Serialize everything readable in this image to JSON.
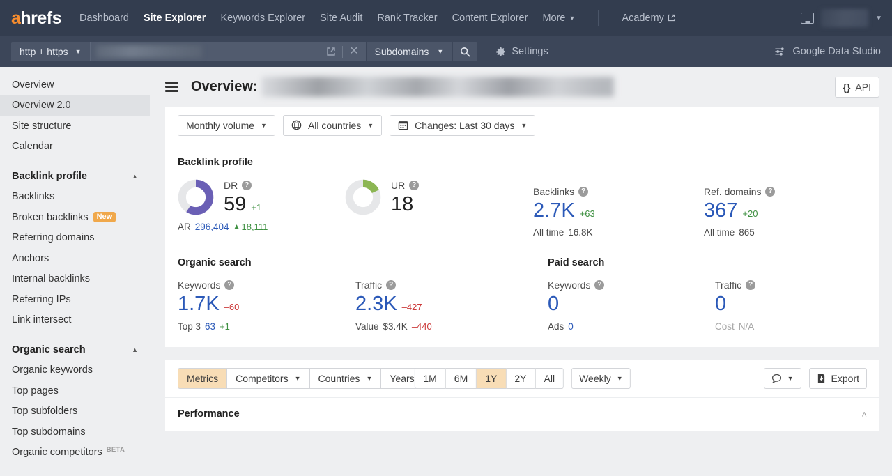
{
  "brand": {
    "logo_a": "a",
    "logo_rest": "hrefs",
    "accent": "#f68c2e"
  },
  "topnav": {
    "links": [
      {
        "label": "Dashboard",
        "active": false,
        "caret": false,
        "external": false
      },
      {
        "label": "Site Explorer",
        "active": true,
        "caret": false,
        "external": false
      },
      {
        "label": "Keywords Explorer",
        "active": false,
        "caret": false,
        "external": false
      },
      {
        "label": "Site Audit",
        "active": false,
        "caret": false,
        "external": false
      },
      {
        "label": "Rank Tracker",
        "active": false,
        "caret": false,
        "external": false
      },
      {
        "label": "Content Explorer",
        "active": false,
        "caret": false,
        "external": false
      },
      {
        "label": "More",
        "active": false,
        "caret": true,
        "external": false
      },
      {
        "label": "Academy",
        "active": false,
        "caret": false,
        "external": true
      }
    ],
    "caret_glyph": "▼",
    "external_glyph": "↗",
    "notifications_icon": "inbox-icon",
    "account_caret": "▼"
  },
  "searchbar": {
    "protocol": "http + https",
    "protocol_caret": "▼",
    "url_value": "",
    "open_external_icon": "external-link-icon",
    "clear_icon": "✕",
    "scope": "Subdomains",
    "scope_caret": "▼",
    "search_icon": "search-icon",
    "settings": "Settings",
    "settings_icon": "gear-icon",
    "data_studio": "Google Data Studio",
    "data_studio_icon": "data-studio-icon"
  },
  "sidebar": {
    "top_items": [
      {
        "label": "Overview",
        "selected": false
      },
      {
        "label": "Overview 2.0",
        "selected": true
      },
      {
        "label": "Site structure",
        "selected": false
      },
      {
        "label": "Calendar",
        "selected": false
      }
    ],
    "groups": [
      {
        "title": "Backlink profile",
        "collapse_glyph": "▲",
        "items": [
          {
            "label": "Backlinks",
            "badge": null
          },
          {
            "label": "Broken backlinks",
            "badge": "New"
          },
          {
            "label": "Referring domains",
            "badge": null
          },
          {
            "label": "Anchors",
            "badge": null
          },
          {
            "label": "Internal backlinks",
            "badge": null
          },
          {
            "label": "Referring IPs",
            "badge": null
          },
          {
            "label": "Link intersect",
            "badge": null
          }
        ]
      },
      {
        "title": "Organic search",
        "collapse_glyph": "▲",
        "items": [
          {
            "label": "Organic keywords",
            "badge": null
          },
          {
            "label": "Top pages",
            "badge": null
          },
          {
            "label": "Top subfolders",
            "badge": null
          },
          {
            "label": "Top subdomains",
            "badge": null
          },
          {
            "label": "Organic competitors",
            "badge": "BETA"
          }
        ]
      }
    ]
  },
  "header": {
    "menu_icon": "hamburger-icon",
    "title": "Overview:",
    "target_redacted": true,
    "api_label": "API",
    "api_icon": "{}"
  },
  "filters": [
    {
      "name": "volume-filter",
      "label": "Monthly volume",
      "icon": null,
      "caret": "▼"
    },
    {
      "name": "country-filter",
      "label": "All countries",
      "icon": "globe-icon",
      "caret": "▼"
    },
    {
      "name": "changes-filter",
      "label": "Changes: Last 30 days",
      "icon": "calendar-icon",
      "caret": "▼"
    }
  ],
  "backlink_profile": {
    "title": "Backlink profile",
    "dr": {
      "label": "DR",
      "value": "59",
      "delta": "+1",
      "delta_dir": "up",
      "donut_pct": 59,
      "donut_color": "#6a5fb5",
      "sub_label": "AR",
      "sub_value": "296,404",
      "sub_delta": "18,111",
      "sub_delta_dir": "up",
      "sub_delta_glyph": "▲"
    },
    "ur": {
      "label": "UR",
      "value": "18",
      "delta": null,
      "donut_pct": 18,
      "donut_color": "#8cb653"
    },
    "backlinks": {
      "label": "Backlinks",
      "value": "2.7K",
      "delta": "+63",
      "delta_dir": "up",
      "sub_label": "All time",
      "sub_value": "16.8K"
    },
    "ref_domains": {
      "label": "Ref. domains",
      "value": "367",
      "delta": "+20",
      "delta_dir": "up",
      "sub_label": "All time",
      "sub_value": "865"
    }
  },
  "organic_search": {
    "title": "Organic search",
    "keywords": {
      "label": "Keywords",
      "value": "1.7K",
      "delta": "–60",
      "delta_dir": "down",
      "sub_label": "Top 3",
      "sub_value": "63",
      "sub_delta": "+1",
      "sub_delta_dir": "up"
    },
    "traffic": {
      "label": "Traffic",
      "value": "2.3K",
      "delta": "–427",
      "delta_dir": "down",
      "sub_label": "Value",
      "sub_value": "$3.4K",
      "sub_delta": "–440",
      "sub_delta_dir": "down"
    }
  },
  "paid_search": {
    "title": "Paid search",
    "keywords": {
      "label": "Keywords",
      "value": "0",
      "sub_label": "Ads",
      "sub_value": "0"
    },
    "traffic": {
      "label": "Traffic",
      "value": "0",
      "sub_label": "Cost",
      "sub_value": "N/A",
      "sub_muted": true
    }
  },
  "toolbar": {
    "tabs": [
      {
        "label": "Metrics",
        "active": true,
        "caret": null
      },
      {
        "label": "Competitors",
        "active": false,
        "caret": "▼"
      },
      {
        "label": "Countries",
        "active": false,
        "caret": "▼"
      },
      {
        "label": "Years",
        "active": false,
        "caret": null
      }
    ],
    "ranges": [
      {
        "label": "1M",
        "active": false
      },
      {
        "label": "6M",
        "active": false
      },
      {
        "label": "1Y",
        "active": true
      },
      {
        "label": "2Y",
        "active": false
      },
      {
        "label": "All",
        "active": false
      }
    ],
    "granularity": {
      "label": "Weekly",
      "caret": "▼"
    },
    "annotations": {
      "icon": "comment-icon",
      "caret": "▼"
    },
    "export": {
      "label": "Export",
      "icon": "download-file-icon"
    }
  },
  "performance": {
    "title": "Performance",
    "collapse_glyph": "˄"
  },
  "colors": {
    "nav_bg": "#333d4f",
    "search_bg": "#3c4659",
    "sidebar_bg": "#eeeff1",
    "link_blue": "#2b59b8",
    "up_green": "#3f9142",
    "down_red": "#cc3a3a",
    "highlight": "#f8ddb6",
    "badge_new": "#f0a84b"
  }
}
